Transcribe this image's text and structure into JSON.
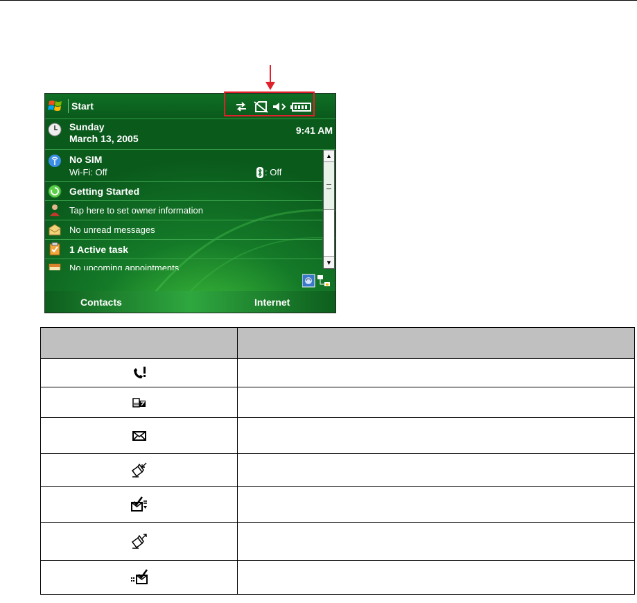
{
  "phone": {
    "start_label": "Start",
    "time": "9:41 AM",
    "rows": [
      {
        "title": "Sunday",
        "subtitle": "March 13, 2005"
      },
      {
        "title": "No SIM",
        "subtitle": "Wi-Fi: Off",
        "bluetooth": ": Off"
      },
      {
        "title": "Getting Started"
      },
      {
        "subtitle": "Tap here to set owner information"
      },
      {
        "subtitle": "No unread messages"
      },
      {
        "title": "1 Active task"
      },
      {
        "subtitle": "No upcoming appointments"
      }
    ],
    "softkeys": {
      "left": "Contacts",
      "right": "Internet"
    }
  },
  "callout": {
    "color": "#e0202a"
  },
  "table": {
    "header": [
      "",
      ""
    ],
    "rows": [
      {
        "icon": "missed-call-icon",
        "description": ""
      },
      {
        "icon": "sms-notification-icon",
        "description": ""
      },
      {
        "icon": "new-email-icon",
        "description": ""
      },
      {
        "icon": "incoming-message-icon",
        "description": ""
      },
      {
        "icon": "receiving-email-icon",
        "description": ""
      },
      {
        "icon": "outgoing-message-icon",
        "description": ""
      },
      {
        "icon": "sending-email-icon",
        "description": ""
      }
    ]
  },
  "colors": {
    "phone_green": "#0d6a22",
    "table_header": "#c0c0c0"
  }
}
